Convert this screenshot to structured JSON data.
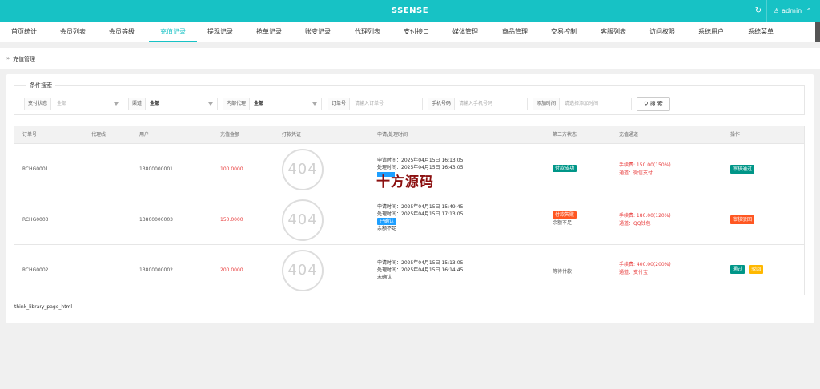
{
  "app": {
    "title": "SSENSE",
    "refresh_icon": "↻",
    "user_icon": "♙",
    "username": "admin",
    "user_caret": "^"
  },
  "nav": {
    "items": [
      "首页统计",
      "会员列表",
      "会员等级",
      "充值记录",
      "提现记录",
      "抢单记录",
      "账变记录",
      "代理列表",
      "支付接口",
      "媒体管理",
      "商品管理",
      "交易控制",
      "客服列表",
      "访问权限",
      "系统用户",
      "系统菜单"
    ],
    "active_index": 3
  },
  "breadcrumb": {
    "arrow": "»",
    "text": "充值管理"
  },
  "search": {
    "legend": "条件搜索",
    "pay_status": {
      "label": "支付状态",
      "value": "全部"
    },
    "channel": {
      "label": "渠道",
      "value": "全部"
    },
    "agent": {
      "label": "内部代理",
      "value": "全部"
    },
    "order_no": {
      "label": "订单号",
      "placeholder": "请输入订单号"
    },
    "phone": {
      "label": "手机号码",
      "placeholder": "请输入手机号码"
    },
    "add_time": {
      "label": "添加时间",
      "placeholder": "请选择添加时间"
    },
    "button": "搜 索",
    "button_icon": "⚲"
  },
  "table": {
    "headers": [
      "订单号",
      "代理线",
      "用户",
      "充值金额",
      "打款凭证",
      "申请/处理时间",
      "第三方状态",
      "充值通道",
      "操作"
    ],
    "rows": [
      {
        "order_no": "RCHG0001",
        "agent": "",
        "user": "13800000001",
        "amount": "100.0000",
        "voucher": "404",
        "apply_time": "申请时间：2025年04月15日 16:13:05",
        "process_time": "处理时间：2025年04月15日 16:43:05",
        "confirm_badge": "",
        "note": "",
        "third_status": "付款成功",
        "third_note": "",
        "fee": "手续费: 150.00(150%)",
        "channel": "通道：微信支付",
        "actions": [
          "审核通过"
        ]
      },
      {
        "order_no": "RCHG0003",
        "agent": "",
        "user": "13800000003",
        "amount": "150.0000",
        "voucher": "404",
        "apply_time": "申请时间：2025年04月15日 15:49:45",
        "process_time": "处理时间：2025年04月15日 17:13:05",
        "confirm_badge": "已确认",
        "note": "余额不足",
        "third_status": "付款失败",
        "third_note": "余额不足",
        "fee": "手续费: 180.00(120%)",
        "channel": "通道：QQ钱包",
        "actions": [
          "审核驳回"
        ]
      },
      {
        "order_no": "RCHG0002",
        "agent": "",
        "user": "13800000002",
        "amount": "200.0000",
        "voucher": "404",
        "apply_time": "申请时间：2025年04月15日 15:13:05",
        "process_time": "处理时间：2025年04月15日 16:14:45",
        "confirm_badge": "",
        "note": "未确认",
        "third_status": "",
        "third_note": "等待付款",
        "fee": "手续费: 400.00(200%)",
        "channel": "通道：支付宝",
        "actions": [
          "通过",
          "驳回"
        ]
      }
    ]
  },
  "pager": "think_library_page_html",
  "watermark": "十方源码"
}
